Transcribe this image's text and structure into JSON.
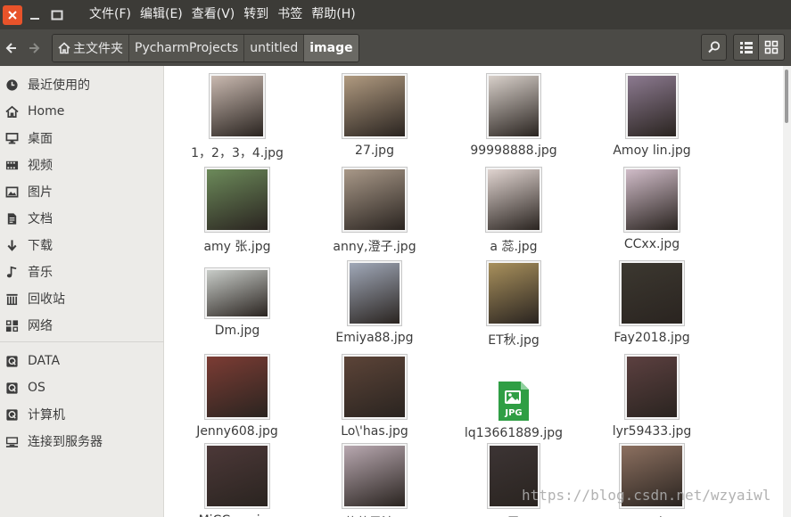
{
  "menu": [
    "文件(F)",
    "编辑(E)",
    "查看(V)",
    "转到",
    "书签",
    "帮助(H)"
  ],
  "breadcrumbs": [
    "主文件夹",
    "PycharmProjects",
    "untitled",
    "image"
  ],
  "sidebar": [
    {
      "label": "最近使用的",
      "icon": "clock-icon"
    },
    {
      "label": "Home",
      "icon": "home-icon"
    },
    {
      "label": "桌面",
      "icon": "desktop-icon"
    },
    {
      "label": "视频",
      "icon": "video-icon"
    },
    {
      "label": "图片",
      "icon": "pictures-icon"
    },
    {
      "label": "文档",
      "icon": "documents-icon"
    },
    {
      "label": "下载",
      "icon": "download-icon"
    },
    {
      "label": "音乐",
      "icon": "music-icon"
    },
    {
      "label": "回收站",
      "icon": "trash-icon"
    },
    {
      "label": "网络",
      "icon": "network-icon"
    },
    {
      "label": "DATA",
      "icon": "drive-icon"
    },
    {
      "label": "OS",
      "icon": "drive-icon"
    },
    {
      "label": "计算机",
      "icon": "computer-drive-icon"
    },
    {
      "label": "连接到服务器",
      "icon": "server-icon"
    }
  ],
  "files": [
    {
      "name": "1，2，3，4.jpg",
      "color": "#c9b9b0"
    },
    {
      "name": "27.jpg",
      "color": "#b09a80"
    },
    {
      "name": "99998888.jpg",
      "color": "#d8d0ca"
    },
    {
      "name": "Amoy lin.jpg",
      "color": "#8c7a90"
    },
    {
      "name": "amy 张.jpg",
      "color": "#6c8a5a"
    },
    {
      "name": "anny,澄子.jpg",
      "color": "#a89888"
    },
    {
      "name": "a 蕊.jpg",
      "color": "#e0d4d0"
    },
    {
      "name": "CCxx.jpg",
      "color": "#d0bcc8"
    },
    {
      "name": "Dm.jpg",
      "color": "#c8ccc8"
    },
    {
      "name": "Emiya88.jpg",
      "color": "#a0a8b8"
    },
    {
      "name": "ET秋.jpg",
      "color": "#a8905c"
    },
    {
      "name": "Fay2018.jpg",
      "color": "#3c3830"
    },
    {
      "name": "Jenny608.jpg",
      "color": "#7c3c34"
    },
    {
      "name": "Lo\\'has.jpg",
      "color": "#5c4438"
    },
    {
      "name": "lq13661889.jpg",
      "icon": "jpg-file-icon",
      "badge": "JPG"
    },
    {
      "name": "lyr59433.jpg",
      "color": "#5c4040"
    },
    {
      "name": "MiCCcen.jpg",
      "color": "#4c3838"
    },
    {
      "name": "ㄇ菠萝果汁.jpg",
      "color": "#b8a8b0"
    },
    {
      "name": "MS 雪.jpg",
      "color": "#3c3434"
    },
    {
      "name": "Queen丨.jpg",
      "color": "#8c7060"
    }
  ],
  "watermark": "https://blog.csdn.net/wzyaiwl"
}
